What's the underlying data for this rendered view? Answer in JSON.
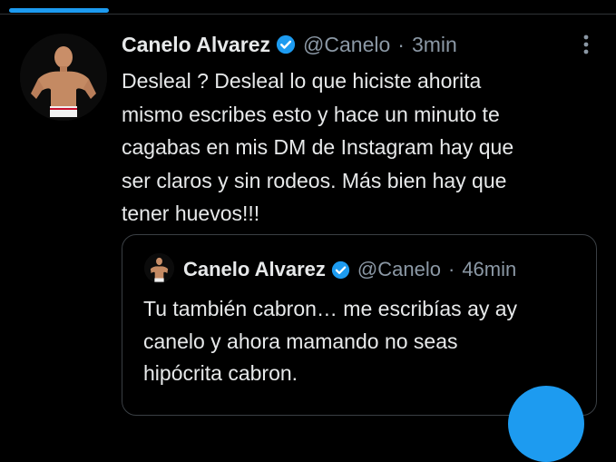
{
  "tweet": {
    "author_name": "Canelo Alvarez",
    "handle": "@Canelo",
    "separator": "·",
    "time": "3min",
    "text": "Desleal ? Desleal lo que hiciste ahorita\nmismo escribes esto y hace un minuto te\ncagabas en mis DM de Instagram hay que\nser claros y sin rodeos. Más bien hay que\ntener huevos!!!"
  },
  "quoted_tweet": {
    "author_name": "Canelo Alvarez",
    "handle": "@Canelo",
    "separator": "·",
    "time": "46min",
    "text": "Tu también cabron… me escribías ay ay\ncanelo y ahora mamando no seas\nhipócrita cabron."
  },
  "icons": {
    "verified": "verified-badge-icon",
    "more": "more-options-icon",
    "fab": "compose-button"
  },
  "colors": {
    "background": "#000000",
    "text": "#e7e9ea",
    "secondary_text": "#8b98a5",
    "accent": "#1d9bf0",
    "border": "#3a3f44"
  }
}
